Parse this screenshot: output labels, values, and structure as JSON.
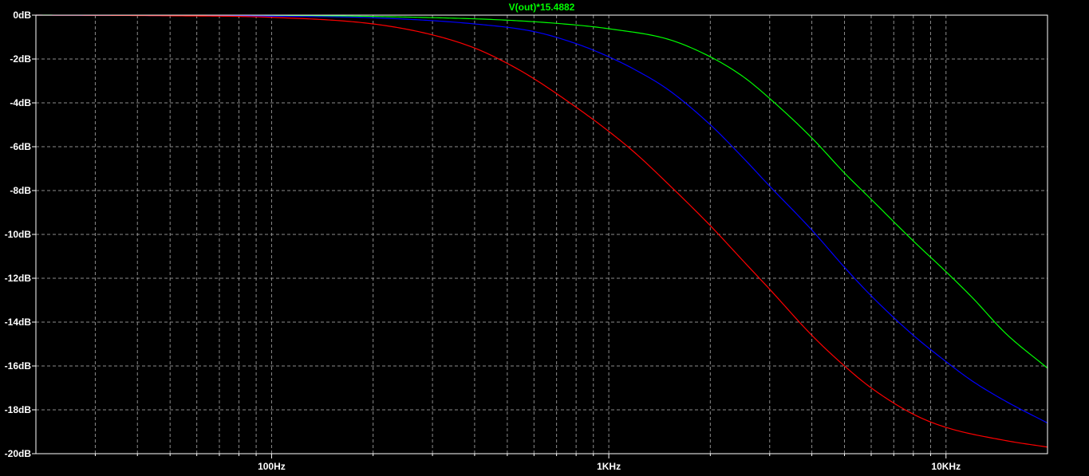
{
  "chart_data": {
    "type": "line",
    "title": "V(out)*15.4882",
    "title_color": "#00ff00",
    "x_scale": "log",
    "xlim": [
      20,
      20000
    ],
    "ylim": [
      -20,
      0
    ],
    "x_tick_labels": [
      {
        "value": 100,
        "label": "100Hz"
      },
      {
        "value": 1000,
        "label": "1KHz"
      },
      {
        "value": 10000,
        "label": "10KHz"
      }
    ],
    "y_tick_labels": [
      {
        "value": 0,
        "label": "0dB"
      },
      {
        "value": -2,
        "label": "-2dB"
      },
      {
        "value": -4,
        "label": "-4dB"
      },
      {
        "value": -6,
        "label": "-6dB"
      },
      {
        "value": -8,
        "label": "-8dB"
      },
      {
        "value": -10,
        "label": "-10dB"
      },
      {
        "value": -12,
        "label": "-12dB"
      },
      {
        "value": -14,
        "label": "-14dB"
      },
      {
        "value": -16,
        "label": "-16dB"
      },
      {
        "value": -18,
        "label": "-18dB"
      },
      {
        "value": -20,
        "label": "-20dB"
      }
    ],
    "grid": true,
    "colors": {
      "background": "#000000",
      "frame": "#ffffff",
      "grid": "#8c8c8c",
      "text": "#ffffff"
    },
    "series": [
      {
        "color": "#00ff00",
        "points": [
          [
            20,
            0
          ],
          [
            100,
            -0.02
          ],
          [
            200,
            -0.06
          ],
          [
            500,
            -0.23
          ],
          [
            800,
            -0.45
          ],
          [
            1000,
            -0.62
          ],
          [
            1500,
            -1.1
          ],
          [
            2000,
            -1.9
          ],
          [
            2500,
            -2.8
          ],
          [
            3000,
            -3.8
          ],
          [
            4000,
            -5.6
          ],
          [
            5000,
            -7.2
          ],
          [
            6000,
            -8.4
          ],
          [
            8000,
            -10.3
          ],
          [
            10000,
            -11.7
          ],
          [
            12000,
            -12.9
          ],
          [
            15000,
            -14.5
          ],
          [
            20000,
            -16.1
          ]
        ]
      },
      {
        "color": "#0000ff",
        "points": [
          [
            20,
            0
          ],
          [
            100,
            -0.05
          ],
          [
            200,
            -0.12
          ],
          [
            400,
            -0.4
          ],
          [
            600,
            -0.75
          ],
          [
            800,
            -1.3
          ],
          [
            1000,
            -1.9
          ],
          [
            1200,
            -2.5
          ],
          [
            1500,
            -3.4
          ],
          [
            2000,
            -5.0
          ],
          [
            2500,
            -6.5
          ],
          [
            3000,
            -7.8
          ],
          [
            4000,
            -9.8
          ],
          [
            5000,
            -11.5
          ],
          [
            6000,
            -12.8
          ],
          [
            8000,
            -14.6
          ],
          [
            10000,
            -15.8
          ],
          [
            12000,
            -16.7
          ],
          [
            15000,
            -17.6
          ],
          [
            20000,
            -18.6
          ]
        ]
      },
      {
        "color": "#ff0000",
        "points": [
          [
            20,
            0
          ],
          [
            50,
            -0.03
          ],
          [
            100,
            -0.1
          ],
          [
            200,
            -0.4
          ],
          [
            300,
            -0.9
          ],
          [
            400,
            -1.5
          ],
          [
            500,
            -2.2
          ],
          [
            600,
            -2.9
          ],
          [
            800,
            -4.2
          ],
          [
            1000,
            -5.3
          ],
          [
            1200,
            -6.3
          ],
          [
            1500,
            -7.7
          ],
          [
            2000,
            -9.6
          ],
          [
            2500,
            -11.2
          ],
          [
            3000,
            -12.5
          ],
          [
            4000,
            -14.6
          ],
          [
            5000,
            -16.0
          ],
          [
            6000,
            -17.0
          ],
          [
            8000,
            -18.2
          ],
          [
            10000,
            -18.8
          ],
          [
            15000,
            -19.4
          ],
          [
            20000,
            -19.7
          ]
        ]
      }
    ]
  }
}
